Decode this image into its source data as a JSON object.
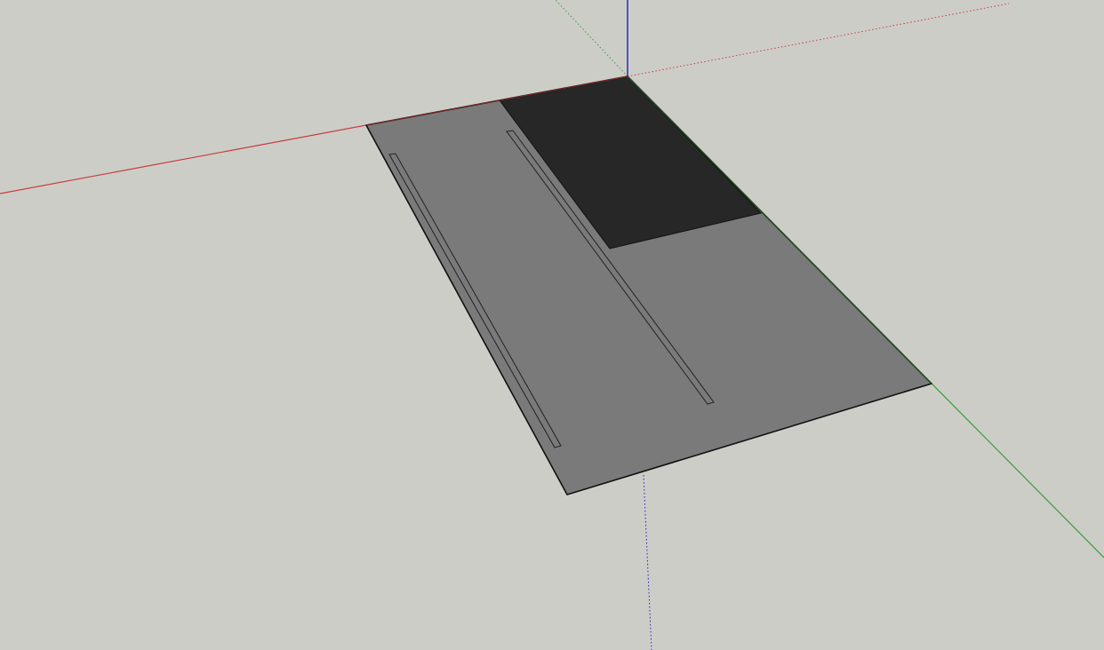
{
  "viewport": {
    "background_color": "#cdcdc8",
    "axes": {
      "red_color": "#c83c3c",
      "green_color": "#3a9c3a",
      "blue_color": "#1e1ec8"
    },
    "model": {
      "slab_color": "#7a7a7a",
      "dark_panel_color": "#272727",
      "edge_color": "#111111",
      "slot_count": 2
    }
  }
}
